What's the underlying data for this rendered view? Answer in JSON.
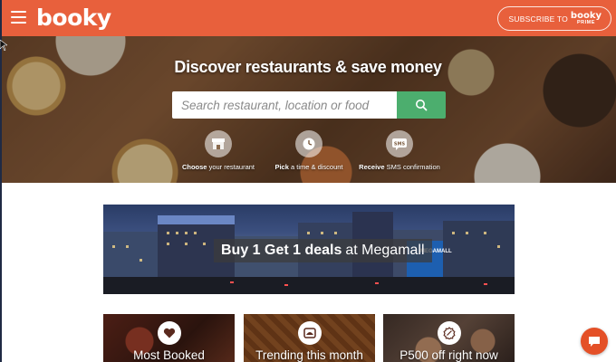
{
  "header": {
    "logo": "booky",
    "subscribe_text": "SUBSCRIBE TO",
    "prime_top": "booky",
    "prime_bottom": "PRIME"
  },
  "hero": {
    "title": "Discover restaurants & save money",
    "search_placeholder": "Search restaurant, location or food",
    "steps": [
      {
        "bold": "Choose",
        "rest": " your restaurant",
        "icon": "storefront-icon"
      },
      {
        "bold": "Pick",
        "rest": " a time & discount",
        "icon": "clock-icon"
      },
      {
        "bold": "Receive",
        "rest": " SMS confirmation",
        "icon": "sms-icon"
      }
    ],
    "sms_badge": "SMS"
  },
  "promo": {
    "bold": "Buy 1 Get 1 deals",
    "rest": "at Megamall",
    "sign": "MEGAMALL"
  },
  "cards": [
    {
      "label": "Most Booked",
      "icon": "heart-icon"
    },
    {
      "label": "Trending this month",
      "icon": "trending-dish-icon"
    },
    {
      "label": "P500 off right now",
      "icon": "discount-tag-icon"
    }
  ],
  "colors": {
    "brand": "#e8603c",
    "search_button": "#4cae6e",
    "chat": "#e45027"
  }
}
